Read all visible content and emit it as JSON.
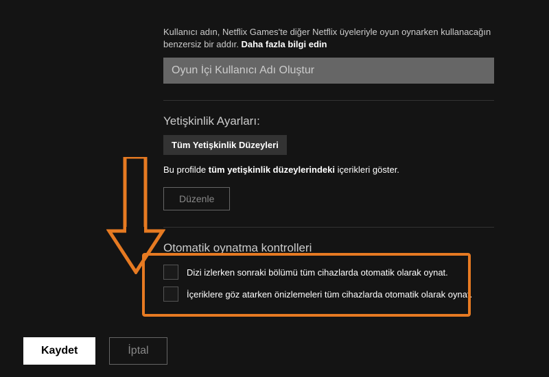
{
  "username": {
    "desc_pre": "Kullanıcı adın, Netflix Games'te diğer Netflix üyeleriyle oyun oynarken kullanacağın benzersiz bir addır.",
    "desc_bold": "Daha fazla bilgi edin",
    "placeholder": "Oyun İçi Kullanıcı Adı Oluştur"
  },
  "maturity": {
    "title": "Yetişkinlik Ayarları:",
    "badge": "Tüm Yetişkinlik Düzeyleri",
    "desc_pre": "Bu profilde ",
    "desc_bold": "tüm yetişkinlik düzeylerindeki",
    "desc_post": " içerikleri göster.",
    "edit": "Düzenle"
  },
  "autoplay": {
    "title": "Otomatik oynatma kontrolleri",
    "opt1": "Dizi izlerken sonraki bölümü tüm cihazlarda otomatik olarak oynat.",
    "opt2": "İçeriklere göz atarken önizlemeleri tüm cihazlarda otomatik olarak oynat."
  },
  "actions": {
    "save": "Kaydet",
    "cancel": "İptal"
  }
}
